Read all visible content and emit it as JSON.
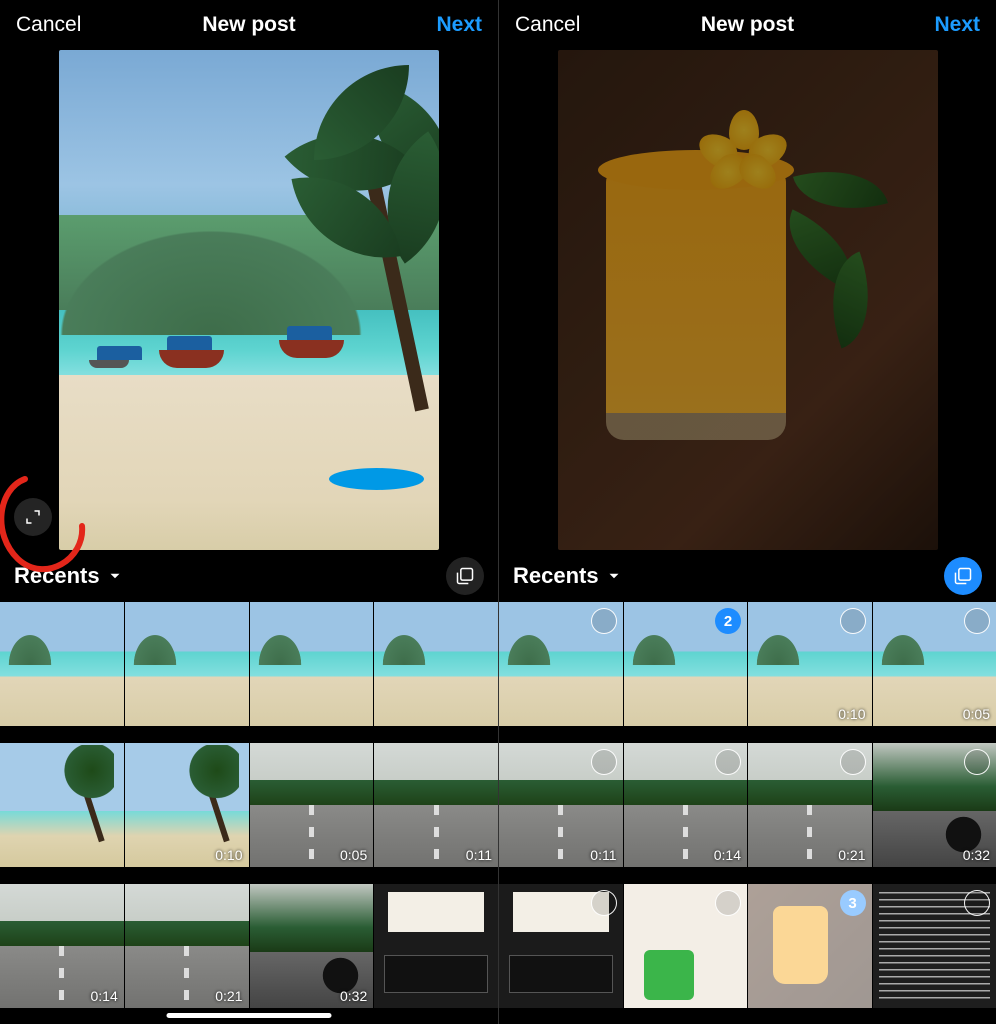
{
  "left": {
    "header": {
      "cancel": "Cancel",
      "title": "New post",
      "next": "Next"
    },
    "album_label": "Recents",
    "multiselect_active": false,
    "grid": [
      {
        "kind": "tb-beach",
        "duration": null,
        "ring": false,
        "num": null,
        "dim": false
      },
      {
        "kind": "tb-beach",
        "duration": null,
        "ring": false,
        "num": null,
        "dim": false
      },
      {
        "kind": "tb-beach",
        "duration": null,
        "ring": false,
        "num": null,
        "dim": false
      },
      {
        "kind": "tb-beach",
        "duration": null,
        "ring": false,
        "num": null,
        "dim": false
      },
      {
        "kind": "tb-palm",
        "duration": null,
        "ring": false,
        "num": null,
        "dim": false
      },
      {
        "kind": "tb-palm",
        "duration": "0:10",
        "ring": false,
        "num": null,
        "dim": false
      },
      {
        "kind": "tb-road",
        "duration": "0:05",
        "ring": false,
        "num": null,
        "dim": false
      },
      {
        "kind": "tb-road",
        "duration": "0:11",
        "ring": false,
        "num": null,
        "dim": false
      },
      {
        "kind": "tb-road",
        "duration": "0:14",
        "ring": false,
        "num": null,
        "dim": false
      },
      {
        "kind": "tb-road",
        "duration": "0:21",
        "ring": false,
        "num": null,
        "dim": false
      },
      {
        "kind": "tb-moto",
        "duration": "0:32",
        "ring": false,
        "num": null,
        "dim": false
      },
      {
        "kind": "tb-sign",
        "duration": null,
        "ring": false,
        "num": null,
        "dim": false
      }
    ]
  },
  "right": {
    "header": {
      "cancel": "Cancel",
      "title": "New post",
      "next": "Next"
    },
    "album_label": "Recents",
    "multiselect_active": true,
    "grid": [
      {
        "kind": "tb-beach",
        "duration": null,
        "ring": true,
        "num": null,
        "dim": false
      },
      {
        "kind": "tb-beach",
        "duration": null,
        "ring": false,
        "num": "2",
        "dim": false
      },
      {
        "kind": "tb-beach",
        "duration": "0:10",
        "ring": true,
        "num": null,
        "dim": false
      },
      {
        "kind": "tb-beach",
        "duration": "0:05",
        "ring": true,
        "num": null,
        "dim": false
      },
      {
        "kind": "tb-road",
        "duration": "0:11",
        "ring": true,
        "num": null,
        "dim": false
      },
      {
        "kind": "tb-road",
        "duration": "0:14",
        "ring": true,
        "num": null,
        "dim": false
      },
      {
        "kind": "tb-road",
        "duration": "0:21",
        "ring": true,
        "num": null,
        "dim": false
      },
      {
        "kind": "tb-moto",
        "duration": "0:32",
        "ring": true,
        "num": null,
        "dim": false
      },
      {
        "kind": "tb-sign",
        "duration": null,
        "ring": true,
        "num": null,
        "dim": false
      },
      {
        "kind": "tb-blog",
        "duration": null,
        "ring": true,
        "num": null,
        "dim": false
      },
      {
        "kind": "tb-smooth",
        "duration": null,
        "ring": false,
        "num": "3",
        "dim": true
      },
      {
        "kind": "tb-text",
        "duration": null,
        "ring": true,
        "num": null,
        "dim": false
      }
    ]
  }
}
